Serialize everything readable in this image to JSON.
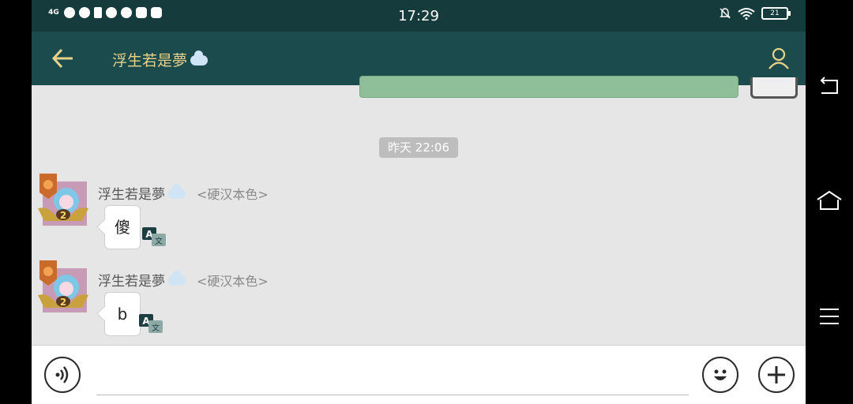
{
  "status_bar": {
    "time": "17:29",
    "network": "4G",
    "battery": "21"
  },
  "header": {
    "title": "浮生若是夢",
    "back_icon": "arrow-left-icon",
    "profile_icon": "person-icon",
    "accent_color": "#e8d28a",
    "bar_color": "#1b4b4c"
  },
  "chat": {
    "timestamp": "昨天 22:06",
    "messages": [
      {
        "sender": "浮生若是夢",
        "tag": "<硬汉本色>",
        "text": "傻"
      },
      {
        "sender": "浮生若是夢",
        "tag": "<硬汉本色>",
        "text": "b"
      }
    ]
  },
  "input": {
    "value": "",
    "placeholder": ""
  },
  "icons": [
    "voice-icon",
    "emoji-icon",
    "plus-icon",
    "translate-icon",
    "nav-back-icon",
    "nav-home-icon",
    "nav-menu-icon"
  ]
}
